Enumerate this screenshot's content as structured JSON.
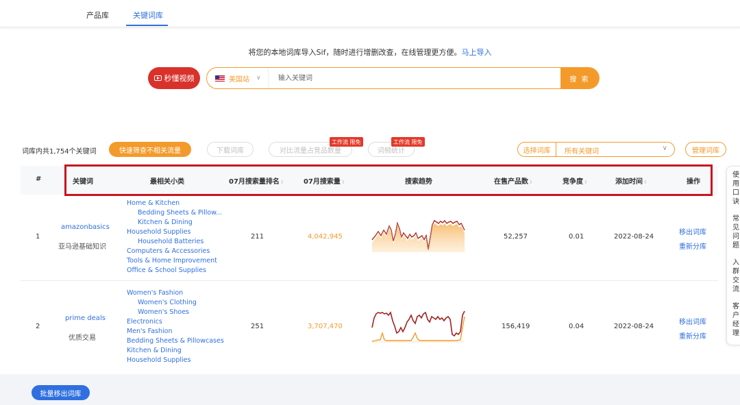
{
  "tabs": [
    {
      "label": "产品库",
      "active": false
    },
    {
      "label": "关键词库",
      "active": true
    }
  ],
  "import_prompt": {
    "text": "将您的本地词库导入Sif，随时进行增删改查，在线管理更方便。",
    "link": "马上导入"
  },
  "search": {
    "video_btn": "秒懂视频",
    "market": "美国站",
    "placeholder": "输入关键词",
    "button": "搜 索"
  },
  "toolbar": {
    "count_text": "词库内共1,754个关键词",
    "quick_btn": "快速筛查不相关流量",
    "download_btn": "下载词库",
    "compare_btn": "对比流量占竞品数量",
    "stats_btn": "词频统计",
    "workflow_tag": "工作流 限免",
    "select_label": "选择词库",
    "select_value": "所有关键词",
    "manage_btn": "管理词库"
  },
  "table": {
    "headers": {
      "index": "#",
      "keyword": "关键词",
      "category": "最相关小类",
      "rank": "07月搜索量排名",
      "volume": "07月搜索量",
      "trend": "搜索趋势",
      "products": "在售产品数",
      "competition": "竞争度",
      "added": "添加时间",
      "action": "操作"
    },
    "rows": [
      {
        "index": "1",
        "keyword": "amazonbasics",
        "translation": "亚马逊基础知识",
        "categories": [
          {
            "label": "Home & Kitchen",
            "level": 0
          },
          {
            "label": "Bedding Sheets & Pillow...",
            "level": 1
          },
          {
            "label": "Kitchen & Dining",
            "level": 1
          },
          {
            "label": "Household Supplies",
            "level": 0
          },
          {
            "label": "Household Batteries",
            "level": 1
          },
          {
            "label": "Computers & Accessories",
            "level": 0
          },
          {
            "label": "Tools & Home Improvement",
            "level": 0
          },
          {
            "label": "Office & School Supplies",
            "level": 0
          }
        ],
        "rank": "211",
        "volume": "4,042,945",
        "products": "52,257",
        "competition": "0.01",
        "added": "2022-08-24",
        "actions": [
          "移出词库",
          "重新分库"
        ]
      },
      {
        "index": "2",
        "keyword": "prime deals",
        "translation": "优质交易",
        "categories": [
          {
            "label": "Women's Fashion",
            "level": 0
          },
          {
            "label": "Women's Clothing",
            "level": 1
          },
          {
            "label": "Women's Shoes",
            "level": 1
          },
          {
            "label": "Electronics",
            "level": 0
          },
          {
            "label": "Men's Fashion",
            "level": 0
          },
          {
            "label": "Bedding Sheets & Pillowcases",
            "level": 0
          },
          {
            "label": "Kitchen & Dining",
            "level": 0
          },
          {
            "label": "Household Supplies",
            "level": 0
          }
        ],
        "rank": "251",
        "volume": "3,707,470",
        "products": "156,419",
        "competition": "0.04",
        "added": "2022-08-24",
        "actions": [
          "移出词库",
          "重新分库"
        ]
      }
    ]
  },
  "side_panel": {
    "groups": [
      "使用口诀",
      "常见问题",
      "入群交流",
      "客户经理"
    ]
  },
  "footer": {
    "batch_btn": "批量移出词库"
  },
  "colors": {
    "accent": "#f39a2a",
    "link": "#2f6fe0",
    "video_red": "#d8322b",
    "frame_red": "#c8141e"
  }
}
